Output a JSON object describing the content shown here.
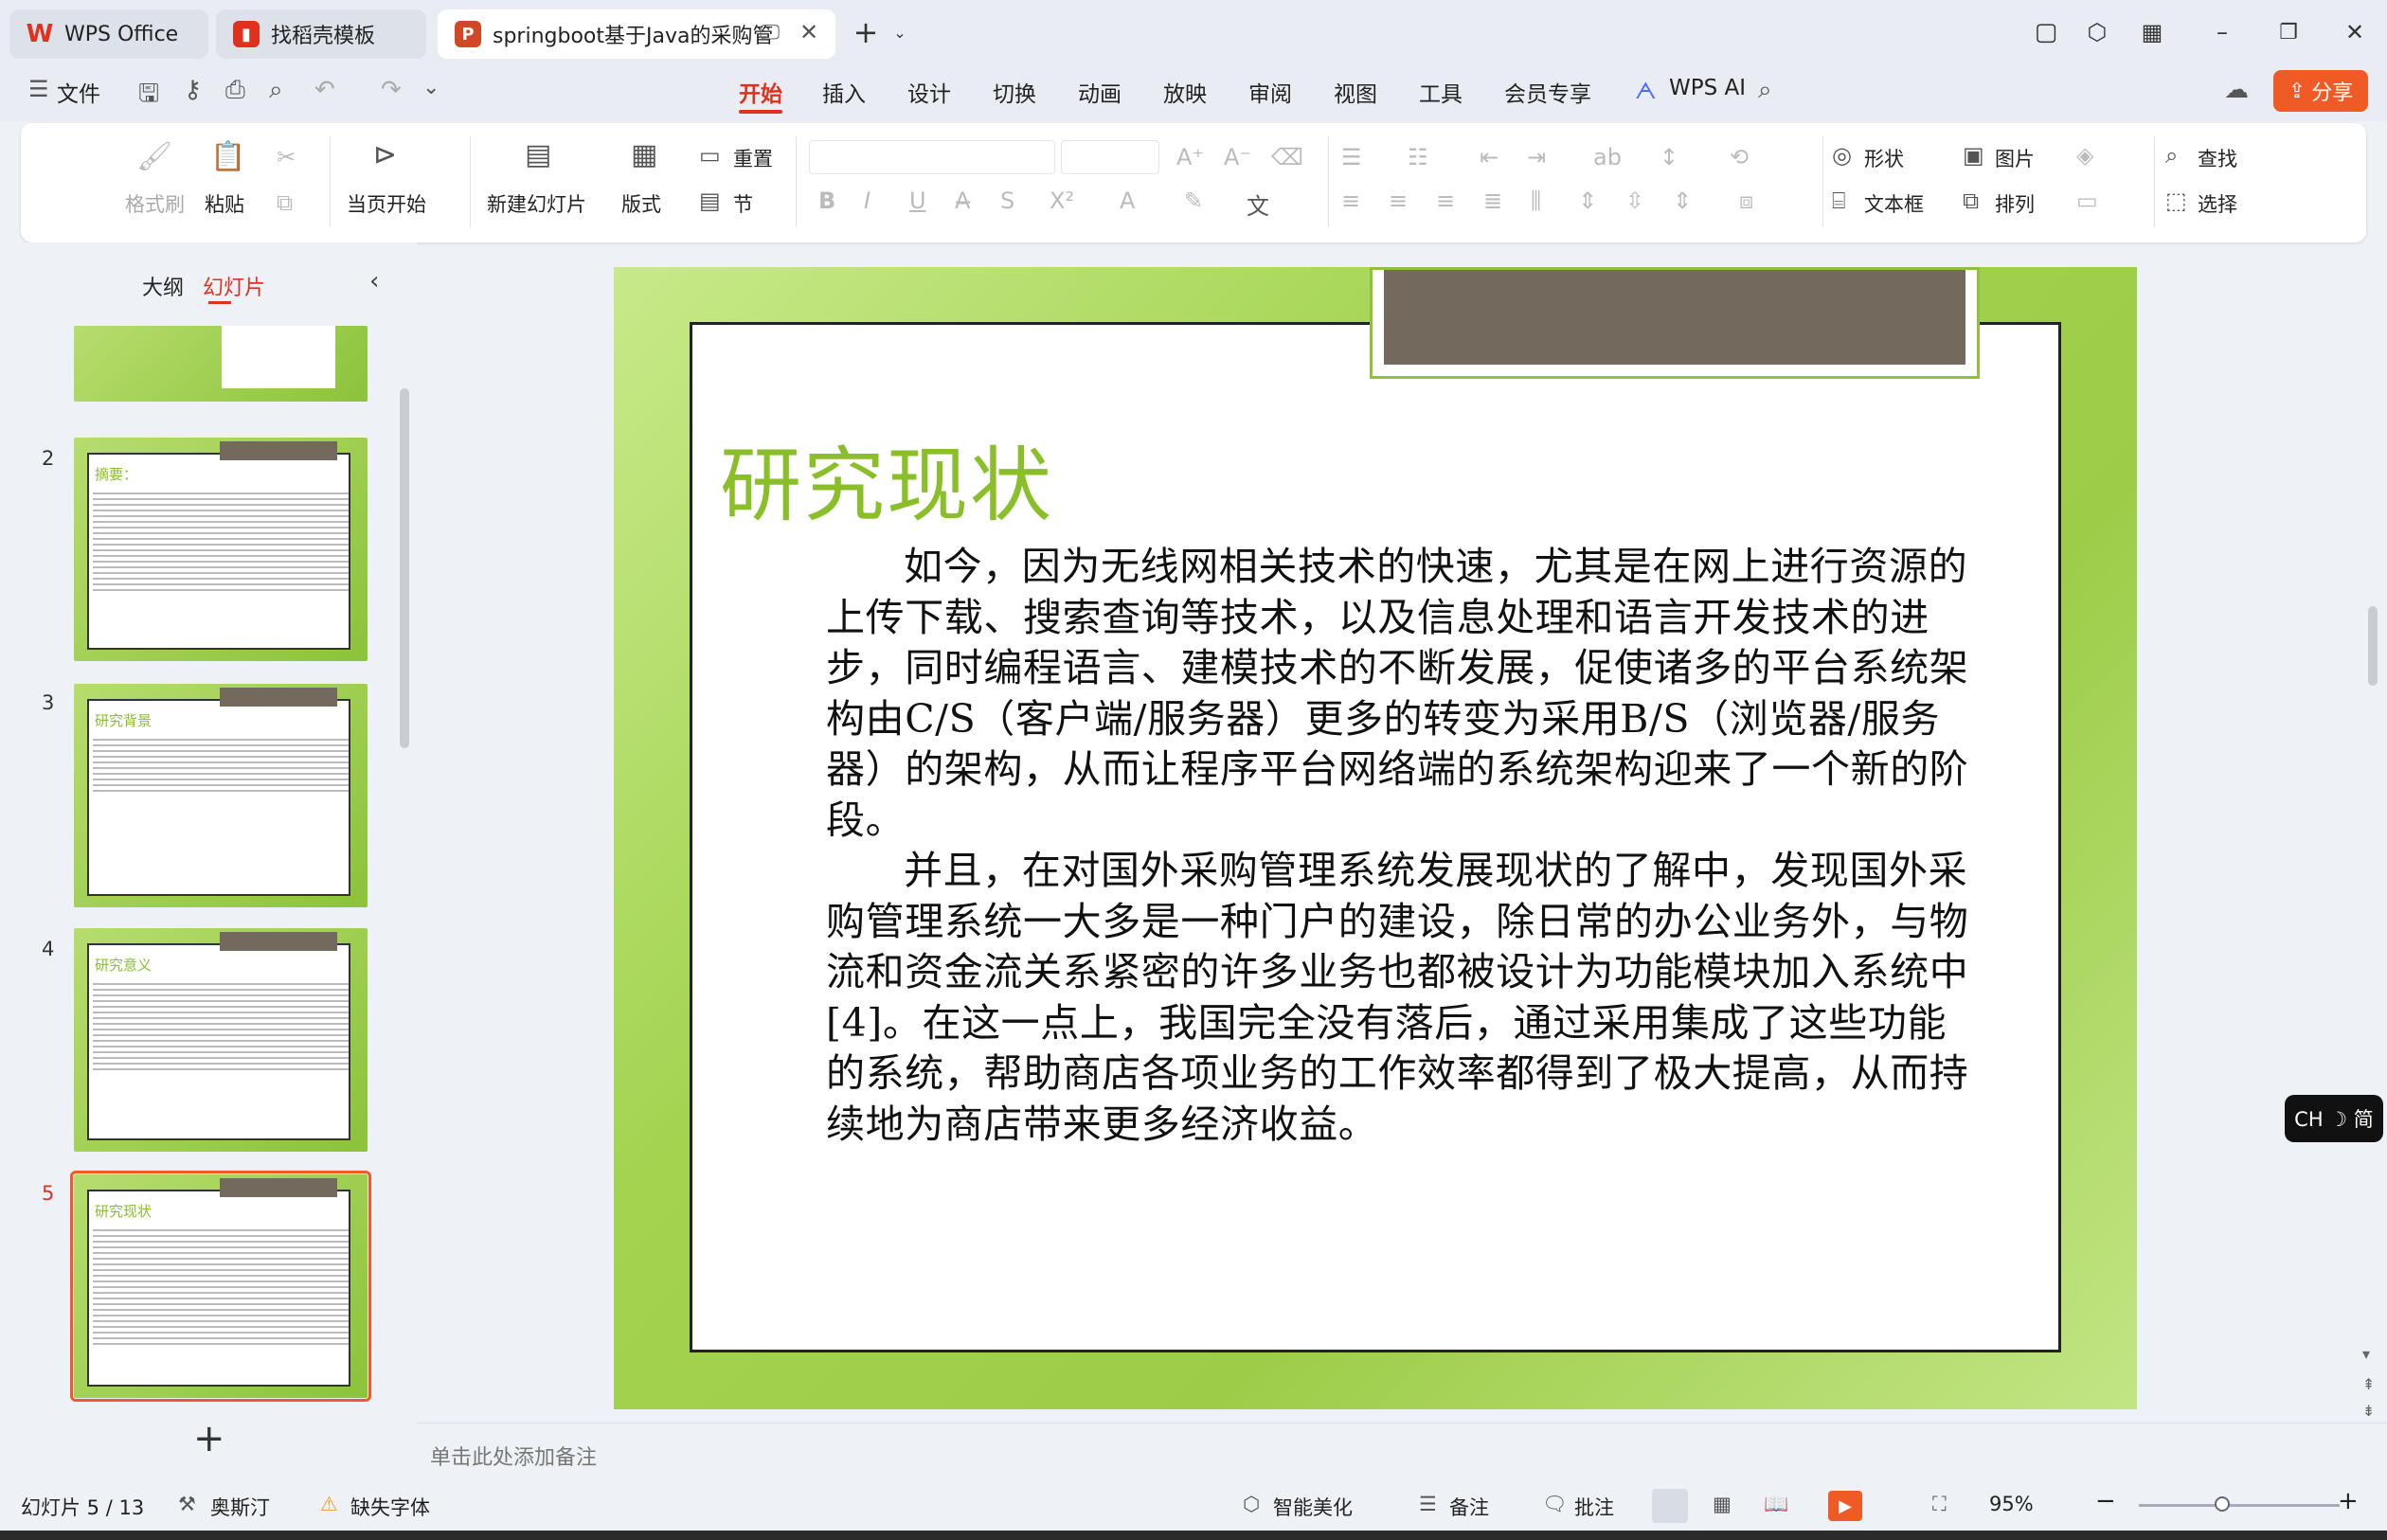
{
  "tabs": [
    {
      "label": "WPS Office",
      "icon": "wps-logo-icon",
      "color": "#e0301e"
    },
    {
      "label": "找稻壳模板",
      "icon": "docer-icon",
      "color": "#e0301e"
    },
    {
      "label": "springboot基于Java的采购管",
      "icon": "presentation-icon",
      "color": "#d24726"
    }
  ],
  "menubar": {
    "file": "文件",
    "items": [
      "开始",
      "插入",
      "设计",
      "切换",
      "动画",
      "放映",
      "审阅",
      "视图",
      "工具",
      "会员专享"
    ],
    "active": "开始",
    "wps_ai": "WPS AI",
    "share": "分享"
  },
  "ribbon": {
    "format_painter": "格式刷",
    "paste": "粘贴",
    "from_current": "当页开始",
    "new_slide": "新建幻灯片",
    "layout": "版式",
    "reset": "重置",
    "section": "节",
    "shape": "形状",
    "picture": "图片",
    "find": "查找",
    "textbox": "文本框",
    "arrange": "排列",
    "select": "选择"
  },
  "panel": {
    "outline_tab": "大纲",
    "slides_tab": "幻灯片",
    "thumbs": [
      {
        "num": "2",
        "title": "摘要："
      },
      {
        "num": "3",
        "title": "研究背景"
      },
      {
        "num": "4",
        "title": "研究意义"
      },
      {
        "num": "5",
        "title": "研究现状"
      }
    ]
  },
  "slide": {
    "title": "研究现状",
    "para1": "如今，因为无线网相关技术的快速，尤其是在网上进行资源的上传下载、搜索查询等技术，以及信息处理和语言开发技术的进步，同时编程语言、建模技术的不断发展，促使诸多的平台系统架构由C/S（客户端/服务器）更多的转变为采用B/S（浏览器/服务器）的架构，从而让程序平台网络端的系统架构迎来了一个新的阶段。",
    "para2": "并且，在对国外采购管理系统发展现状的了解中，发现国外采购管理系统一大多是一种门户的建设，除日常的办公业务外，与物流和资金流关系紧密的许多业务也都被设计为功能模块加入系统中[4]。在这一点上，我国完全没有落后，通过采用集成了这些功能的系统，帮助商店各项业务的工作效率都得到了极大提高，从而持续地为商店带来更多经济收益。"
  },
  "notes_placeholder": "单击此处添加备注",
  "status": {
    "slide_counter": "幻灯片 5 / 13",
    "theme": "奥斯汀",
    "missing_font": "缺失字体",
    "smart": "智能美化",
    "notes": "备注",
    "comment": "批注",
    "zoom": "95%"
  },
  "ime": "CH ☽ 简",
  "colors": {
    "accent": "#e0301e",
    "slide_green": "#8abf2a",
    "brown": "#73695c",
    "share_bg": "#f05a24"
  }
}
